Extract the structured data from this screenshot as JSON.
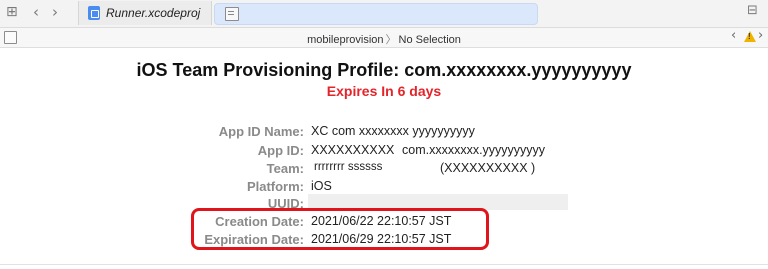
{
  "tabs": [
    {
      "label": "Runner.xcodeproj",
      "icon": "xcodeproj-icon"
    },
    {
      "label": "",
      "icon": "certificate-icon",
      "active": true
    }
  ],
  "pathbar": {
    "crumb1": "mobileprovision",
    "crumb2": "No Selection"
  },
  "profile": {
    "title": "iOS Team Provisioning Profile: com.xxxxxxxx.yyyyyyyyyy",
    "expires": "Expires In 6 days",
    "fields": {
      "app_id_name": {
        "label": "App ID Name:",
        "value": "XC com xxxxxxxx yyyyyyyyyy"
      },
      "app_id": {
        "label": "App ID:",
        "value": "XXXXXXXXXX",
        "value2": "com.xxxxxxxx.yyyyyyyyyy"
      },
      "team": {
        "label": "Team:",
        "value": "rrrrrrrr ssssss",
        "value2": "(XXXXXXXXXX )"
      },
      "platform": {
        "label": "Platform:",
        "value": "iOS"
      },
      "uuid": {
        "label": "UUID:",
        "value": ""
      },
      "creation_date": {
        "label": "Creation Date:",
        "value": "2021/06/22 22:10:57 JST"
      },
      "expiration_date": {
        "label": "Expiration Date:",
        "value": "2021/06/29 22:10:57 JST"
      }
    }
  },
  "colors": {
    "expires": "#e3242b",
    "highlight_border": "#e0151b",
    "label": "#8a8a8a"
  }
}
